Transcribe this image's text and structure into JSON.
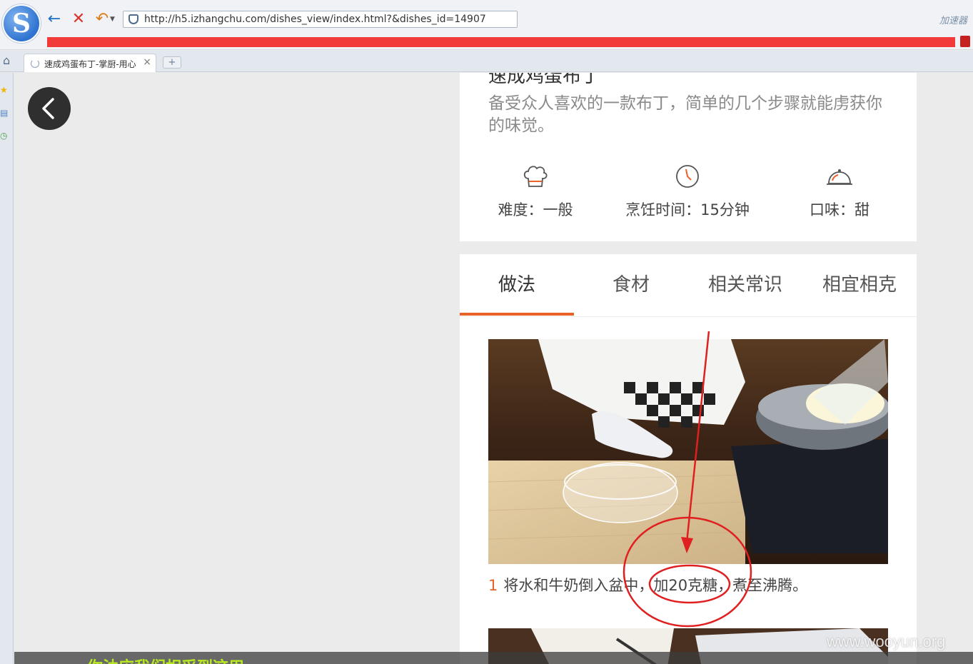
{
  "browser": {
    "url": "http://h5.izhangchu.com/dishes_view/index.html?&dishes_id=14907",
    "accelerator_label": "加速器",
    "tab_title": "速成鸡蛋布丁-掌厨-用心",
    "new_tab_label": "+"
  },
  "page": {
    "dish_title": "速成鸡蛋布丁",
    "description": "备受众人喜欢的一款布丁，简单的几个步骤就能虏获你的味觉。",
    "stats": [
      {
        "icon": "chef-hat-icon",
        "text": "难度：一般"
      },
      {
        "icon": "clock-icon",
        "text": "烹饪时间：15分钟"
      },
      {
        "icon": "cloche-icon",
        "text": "口味：甜"
      }
    ],
    "tabs": [
      "做法",
      "食材",
      "相关常识",
      "相宜相克"
    ],
    "active_tab": "做法",
    "steps": [
      {
        "number": "1",
        "text": "将水和牛奶倒入盆中，加20克糖，煮至沸腾。"
      }
    ],
    "accent_color": "#e8622a"
  },
  "overlay": {
    "bottom_text": "你油应我们相采到这用",
    "watermark": "www.wooyun.org"
  },
  "annotation": {
    "color": "#e02020",
    "shape": "circle-with-arrow"
  }
}
